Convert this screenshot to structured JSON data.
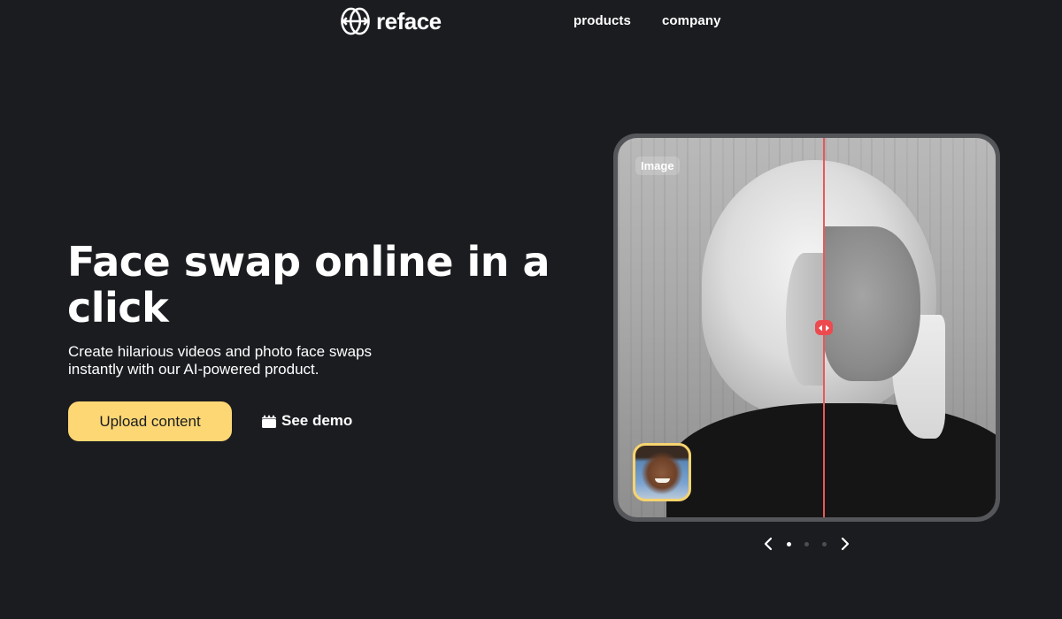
{
  "header": {
    "logo_text": "reface",
    "nav": [
      {
        "label": "products"
      },
      {
        "label": "company"
      }
    ]
  },
  "hero": {
    "title": "Face swap online in a click",
    "subtitle": "Create hilarious videos and photo face swaps instantly with our AI-powered product.",
    "upload_button": "Upload content",
    "demo_link": "See demo"
  },
  "preview": {
    "badge": "Image",
    "slider_icon": "left-right-arrows-icon",
    "thumbnail_alt": "source face thumbnail"
  },
  "carousel": {
    "prev_icon": "chevron-left-icon",
    "next_icon": "chevron-right-icon",
    "total_slides": 3,
    "active_index": 0
  },
  "colors": {
    "background": "#1b1c20",
    "accent_yellow": "#fcd774",
    "slider_red": "#ec4a4f",
    "text": "#ffffff"
  }
}
